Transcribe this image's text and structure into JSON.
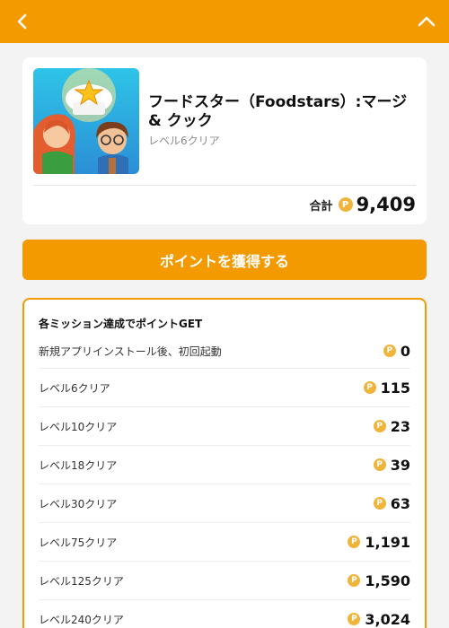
{
  "app": {
    "title": "フードスター（Foodstars）:マージ & クック",
    "status": "レベル6クリア",
    "total_label": "合計",
    "total_points": "9,409"
  },
  "cta": {
    "label": "ポイントを獲得する"
  },
  "missions": {
    "header": "各ミッション達成でポイントGET",
    "items": [
      {
        "label": "新規アプリインストール後、初回起動",
        "points": "0"
      },
      {
        "label": "レベル6クリア",
        "points": "115"
      },
      {
        "label": "レベル10クリア",
        "points": "23"
      },
      {
        "label": "レベル18クリア",
        "points": "39"
      },
      {
        "label": "レベル30クリア",
        "points": "63"
      },
      {
        "label": "レベル75クリア",
        "points": "1,191"
      },
      {
        "label": "レベル125クリア",
        "points": "1,590"
      },
      {
        "label": "レベル240クリア",
        "points": "3,024"
      }
    ]
  },
  "coin_symbol": "P",
  "colors": {
    "accent": "#f39a00",
    "coin": "#f0b43a",
    "background": "#f3f3f3"
  },
  "icons": {
    "back": "chevron-left-icon",
    "collapse": "chevron-up-icon",
    "point": "point-coin-icon"
  }
}
